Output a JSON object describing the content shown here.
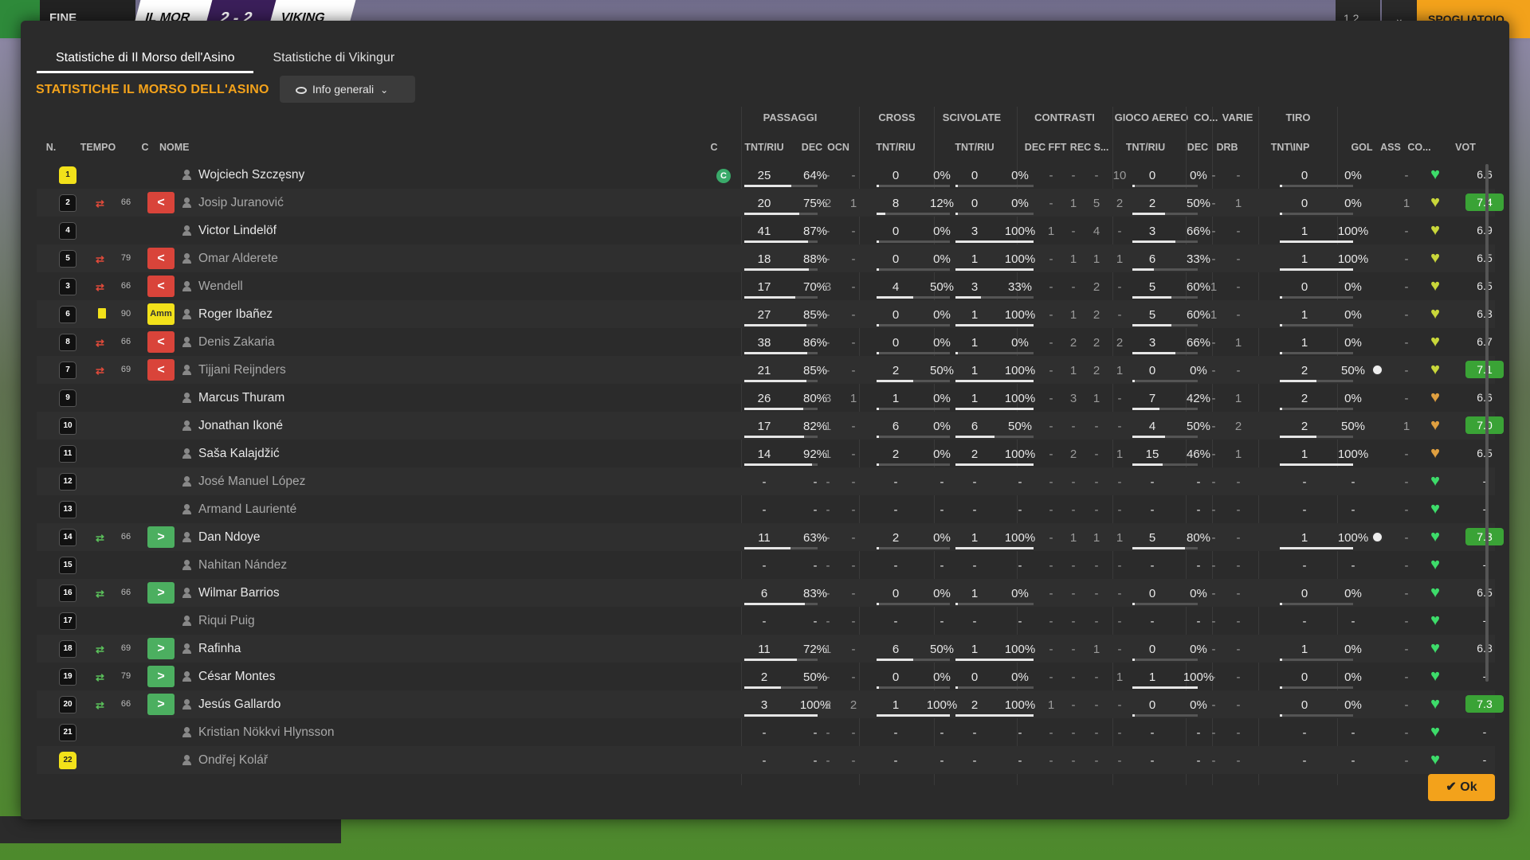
{
  "topbar": {
    "fine_partita": "FINE PARTITA",
    "team1": "IL MOR",
    "score": "2 - 2",
    "team2": "VIKING",
    "ratio": "1.2",
    "spogliatoio": "SPOGLIATOIO"
  },
  "tabs": [
    "Statistiche di Il Morso dell'Asino",
    "Statistiche di Vikingur"
  ],
  "section_title": "STATISTICHE IL MORSO DELL'ASINO",
  "dropdown_label": "Info generali",
  "groups": [
    "PASSAGGI",
    "CROSS",
    "SCIVOLATE",
    "CONTRASTI",
    "GIOCO AEREO",
    "CO...",
    "VARIE",
    "TIRO"
  ],
  "columns": [
    "N.",
    "TEMPO",
    "C",
    "NOME",
    "C",
    "TNT/RIU",
    "DEC",
    "OCN",
    "TNT/RIU",
    "TNT/RIU",
    "DEC",
    "FFT",
    "REC",
    "S...",
    "TNT/RIU",
    "DEC",
    "DRB",
    "TNT\\INP",
    "GOL",
    "ASS",
    "CO...",
    "VOT"
  ],
  "ok_label": "Ok",
  "players": [
    {
      "n": "1",
      "gk": true,
      "min": "",
      "sub": "",
      "c": "",
      "name": "Wojciech Szczęsny",
      "active": true,
      "captain": "C",
      "pass": [
        "25",
        "64%"
      ],
      "pdec": "-",
      "pocn": "-",
      "cross": [
        "0",
        "0%"
      ],
      "sciv": [
        "0",
        "0%"
      ],
      "cdec": "-",
      "fft": "-",
      "rec": "-",
      "s": "10",
      "aer": [
        "0",
        "0%"
      ],
      "codec": "-",
      "drb": "-",
      "tiro": [
        "0",
        "0%"
      ],
      "gol": "",
      "ass": "-",
      "heart": "g",
      "vot": "6.6",
      "good": false
    },
    {
      "n": "2",
      "gk": false,
      "min": "66",
      "sub": "out",
      "c": "<",
      "name": "Josip Juranović",
      "active": false,
      "pass": [
        "20",
        "75%"
      ],
      "pdec": "2",
      "pocn": "1",
      "cross": [
        "8",
        "12%"
      ],
      "sciv": [
        "0",
        "0%"
      ],
      "cdec": "-",
      "fft": "1",
      "rec": "5",
      "s": "2",
      "aer": [
        "2",
        "50%"
      ],
      "codec": "-",
      "drb": "1",
      "tiro": [
        "0",
        "0%"
      ],
      "gol": "",
      "ass": "1",
      "heart": "y",
      "vot": "7.4",
      "good": true
    },
    {
      "n": "4",
      "gk": false,
      "min": "",
      "sub": "",
      "c": "",
      "name": "Victor Lindelöf",
      "active": true,
      "pass": [
        "41",
        "87%"
      ],
      "pdec": "-",
      "pocn": "-",
      "cross": [
        "0",
        "0%"
      ],
      "sciv": [
        "3",
        "100%"
      ],
      "cdec": "1",
      "fft": "-",
      "rec": "4",
      "s": "-",
      "aer": [
        "3",
        "66%"
      ],
      "codec": "-",
      "drb": "-",
      "tiro": [
        "1",
        "100%"
      ],
      "gol": "",
      "ass": "-",
      "heart": "y",
      "vot": "6.9",
      "good": false
    },
    {
      "n": "5",
      "gk": false,
      "min": "79",
      "sub": "out",
      "c": "<",
      "name": "Omar Alderete",
      "active": false,
      "pass": [
        "18",
        "88%"
      ],
      "pdec": "-",
      "pocn": "-",
      "cross": [
        "0",
        "0%"
      ],
      "sciv": [
        "1",
        "100%"
      ],
      "cdec": "-",
      "fft": "1",
      "rec": "1",
      "s": "1",
      "aer": [
        "6",
        "33%"
      ],
      "codec": "-",
      "drb": "-",
      "tiro": [
        "1",
        "100%"
      ],
      "gol": "",
      "ass": "-",
      "heart": "y",
      "vot": "6.5",
      "good": false
    },
    {
      "n": "3",
      "gk": false,
      "min": "66",
      "sub": "out",
      "c": "<",
      "name": "Wendell",
      "active": false,
      "pass": [
        "17",
        "70%"
      ],
      "pdec": "3",
      "pocn": "-",
      "cross": [
        "4",
        "50%"
      ],
      "sciv": [
        "3",
        "33%"
      ],
      "cdec": "-",
      "fft": "-",
      "rec": "2",
      "s": "-",
      "aer": [
        "5",
        "60%"
      ],
      "codec": "1",
      "drb": "-",
      "tiro": [
        "0",
        "0%"
      ],
      "gol": "",
      "ass": "-",
      "heart": "y",
      "vot": "6.5",
      "good": false
    },
    {
      "n": "6",
      "gk": false,
      "min": "90",
      "sub": "yellow",
      "c": "Amm",
      "name": "Roger Ibañez",
      "active": true,
      "pass": [
        "27",
        "85%"
      ],
      "pdec": "-",
      "pocn": "-",
      "cross": [
        "0",
        "0%"
      ],
      "sciv": [
        "1",
        "100%"
      ],
      "cdec": "-",
      "fft": "1",
      "rec": "2",
      "s": "-",
      "aer": [
        "5",
        "60%"
      ],
      "codec": "1",
      "drb": "-",
      "tiro": [
        "1",
        "0%"
      ],
      "gol": "",
      "ass": "-",
      "heart": "y",
      "vot": "6.3",
      "good": false
    },
    {
      "n": "8",
      "gk": false,
      "min": "66",
      "sub": "out",
      "c": "<",
      "name": "Denis Zakaria",
      "active": false,
      "pass": [
        "38",
        "86%"
      ],
      "pdec": "-",
      "pocn": "-",
      "cross": [
        "0",
        "0%"
      ],
      "sciv": [
        "1",
        "0%"
      ],
      "cdec": "-",
      "fft": "2",
      "rec": "2",
      "s": "2",
      "aer": [
        "3",
        "66%"
      ],
      "codec": "-",
      "drb": "1",
      "tiro": [
        "1",
        "0%"
      ],
      "gol": "",
      "ass": "-",
      "heart": "y",
      "vot": "6.7",
      "good": false
    },
    {
      "n": "7",
      "gk": false,
      "min": "69",
      "sub": "out",
      "c": "<",
      "name": "Tijjani Reijnders",
      "active": false,
      "pass": [
        "21",
        "85%"
      ],
      "pdec": "-",
      "pocn": "-",
      "cross": [
        "2",
        "50%"
      ],
      "sciv": [
        "1",
        "100%"
      ],
      "cdec": "-",
      "fft": "1",
      "rec": "2",
      "s": "1",
      "aer": [
        "0",
        "0%"
      ],
      "codec": "-",
      "drb": "-",
      "tiro": [
        "2",
        "50%"
      ],
      "gol": "ball",
      "ass": "-",
      "heart": "y",
      "vot": "7.1",
      "good": true
    },
    {
      "n": "9",
      "gk": false,
      "min": "",
      "sub": "",
      "c": "",
      "name": "Marcus Thuram",
      "active": true,
      "pass": [
        "26",
        "80%"
      ],
      "pdec": "3",
      "pocn": "1",
      "cross": [
        "1",
        "0%"
      ],
      "sciv": [
        "1",
        "100%"
      ],
      "cdec": "-",
      "fft": "3",
      "rec": "1",
      "s": "-",
      "aer": [
        "7",
        "42%"
      ],
      "codec": "-",
      "drb": "1",
      "tiro": [
        "2",
        "0%"
      ],
      "gol": "",
      "ass": "-",
      "heart": "o",
      "vot": "6.6",
      "good": false
    },
    {
      "n": "10",
      "gk": false,
      "min": "",
      "sub": "",
      "c": "",
      "name": "Jonathan Ikoné",
      "active": true,
      "pass": [
        "17",
        "82%"
      ],
      "pdec": "1",
      "pocn": "-",
      "cross": [
        "6",
        "0%"
      ],
      "sciv": [
        "6",
        "50%"
      ],
      "cdec": "-",
      "fft": "-",
      "rec": "-",
      "s": "-",
      "aer": [
        "4",
        "50%"
      ],
      "codec": "-",
      "drb": "2",
      "tiro": [
        "2",
        "50%"
      ],
      "gol": "",
      "ass": "1",
      "heart": "o",
      "vot": "7.0",
      "good": true
    },
    {
      "n": "11",
      "gk": false,
      "min": "",
      "sub": "",
      "c": "",
      "name": "Saša Kalajdžić",
      "active": true,
      "pass": [
        "14",
        "92%"
      ],
      "pdec": "1",
      "pocn": "-",
      "cross": [
        "2",
        "0%"
      ],
      "sciv": [
        "2",
        "100%"
      ],
      "cdec": "-",
      "fft": "2",
      "rec": "-",
      "s": "1",
      "aer": [
        "15",
        "46%"
      ],
      "codec": "-",
      "drb": "1",
      "tiro": [
        "1",
        "100%"
      ],
      "gol": "",
      "ass": "-",
      "heart": "o",
      "vot": "6.5",
      "good": false
    },
    {
      "n": "12",
      "gk": false,
      "min": "",
      "sub": "",
      "c": "",
      "name": "José Manuel López",
      "active": false,
      "pass": [
        "-",
        "-"
      ],
      "pdec": "-",
      "pocn": "-",
      "cross": [
        "-",
        "-"
      ],
      "sciv": [
        "-",
        "-"
      ],
      "cdec": "-",
      "fft": "-",
      "rec": "-",
      "s": "-",
      "aer": [
        "-",
        "-"
      ],
      "codec": "-",
      "drb": "-",
      "tiro": [
        "-",
        "-"
      ],
      "gol": "",
      "ass": "-",
      "heart": "g",
      "vot": "-",
      "good": false
    },
    {
      "n": "13",
      "gk": false,
      "min": "",
      "sub": "",
      "c": "",
      "name": "Armand Laurienté",
      "active": false,
      "pass": [
        "-",
        "-"
      ],
      "pdec": "-",
      "pocn": "-",
      "cross": [
        "-",
        "-"
      ],
      "sciv": [
        "-",
        "-"
      ],
      "cdec": "-",
      "fft": "-",
      "rec": "-",
      "s": "-",
      "aer": [
        "-",
        "-"
      ],
      "codec": "-",
      "drb": "-",
      "tiro": [
        "-",
        "-"
      ],
      "gol": "",
      "ass": "-",
      "heart": "g",
      "vot": "-",
      "good": false
    },
    {
      "n": "14",
      "gk": false,
      "min": "66",
      "sub": "in",
      "c": ">",
      "name": "Dan Ndoye",
      "active": true,
      "pass": [
        "11",
        "63%"
      ],
      "pdec": "-",
      "pocn": "-",
      "cross": [
        "2",
        "0%"
      ],
      "sciv": [
        "1",
        "100%"
      ],
      "cdec": "-",
      "fft": "1",
      "rec": "1",
      "s": "1",
      "aer": [
        "5",
        "80%"
      ],
      "codec": "-",
      "drb": "-",
      "tiro": [
        "1",
        "100%"
      ],
      "gol": "ball",
      "ass": "-",
      "heart": "g",
      "vot": "7.3",
      "good": true
    },
    {
      "n": "15",
      "gk": false,
      "min": "",
      "sub": "",
      "c": "",
      "name": "Nahitan Nández",
      "active": false,
      "pass": [
        "-",
        "-"
      ],
      "pdec": "-",
      "pocn": "-",
      "cross": [
        "-",
        "-"
      ],
      "sciv": [
        "-",
        "-"
      ],
      "cdec": "-",
      "fft": "-",
      "rec": "-",
      "s": "-",
      "aer": [
        "-",
        "-"
      ],
      "codec": "-",
      "drb": "-",
      "tiro": [
        "-",
        "-"
      ],
      "gol": "",
      "ass": "-",
      "heart": "g",
      "vot": "-",
      "good": false
    },
    {
      "n": "16",
      "gk": false,
      "min": "66",
      "sub": "in",
      "c": ">",
      "name": "Wilmar Barrios",
      "active": true,
      "pass": [
        "6",
        "83%"
      ],
      "pdec": "-",
      "pocn": "-",
      "cross": [
        "0",
        "0%"
      ],
      "sciv": [
        "1",
        "0%"
      ],
      "cdec": "-",
      "fft": "-",
      "rec": "-",
      "s": "-",
      "aer": [
        "0",
        "0%"
      ],
      "codec": "-",
      "drb": "-",
      "tiro": [
        "0",
        "0%"
      ],
      "gol": "",
      "ass": "-",
      "heart": "g",
      "vot": "6.5",
      "good": false
    },
    {
      "n": "17",
      "gk": false,
      "min": "",
      "sub": "",
      "c": "",
      "name": "Riqui Puig",
      "active": false,
      "pass": [
        "-",
        "-"
      ],
      "pdec": "-",
      "pocn": "-",
      "cross": [
        "-",
        "-"
      ],
      "sciv": [
        "-",
        "-"
      ],
      "cdec": "-",
      "fft": "-",
      "rec": "-",
      "s": "-",
      "aer": [
        "-",
        "-"
      ],
      "codec": "-",
      "drb": "-",
      "tiro": [
        "-",
        "-"
      ],
      "gol": "",
      "ass": "-",
      "heart": "g",
      "vot": "-",
      "good": false
    },
    {
      "n": "18",
      "gk": false,
      "min": "69",
      "sub": "in",
      "c": ">",
      "name": "Rafinha",
      "active": true,
      "pass": [
        "11",
        "72%"
      ],
      "pdec": "1",
      "pocn": "-",
      "cross": [
        "6",
        "50%"
      ],
      "sciv": [
        "1",
        "100%"
      ],
      "cdec": "-",
      "fft": "-",
      "rec": "1",
      "s": "-",
      "aer": [
        "0",
        "0%"
      ],
      "codec": "-",
      "drb": "-",
      "tiro": [
        "1",
        "0%"
      ],
      "gol": "",
      "ass": "-",
      "heart": "g",
      "vot": "6.8",
      "good": false
    },
    {
      "n": "19",
      "gk": false,
      "min": "79",
      "sub": "in",
      "c": ">",
      "name": "César Montes",
      "active": true,
      "pass": [
        "2",
        "50%"
      ],
      "pdec": "-",
      "pocn": "-",
      "cross": [
        "0",
        "0%"
      ],
      "sciv": [
        "0",
        "0%"
      ],
      "cdec": "-",
      "fft": "-",
      "rec": "-",
      "s": "1",
      "aer": [
        "1",
        "100%"
      ],
      "codec": "-",
      "drb": "-",
      "tiro": [
        "0",
        "0%"
      ],
      "gol": "",
      "ass": "-",
      "heart": "g",
      "vot": "-",
      "good": false
    },
    {
      "n": "20",
      "gk": false,
      "min": "66",
      "sub": "in",
      "c": ">",
      "name": "Jesús Gallardo",
      "active": true,
      "pass": [
        "3",
        "100%"
      ],
      "pdec": "2",
      "pocn": "2",
      "cross": [
        "1",
        "100%"
      ],
      "sciv": [
        "2",
        "100%"
      ],
      "cdec": "1",
      "fft": "-",
      "rec": "-",
      "s": "-",
      "aer": [
        "0",
        "0%"
      ],
      "codec": "-",
      "drb": "-",
      "tiro": [
        "0",
        "0%"
      ],
      "gol": "",
      "ass": "-",
      "heart": "g",
      "vot": "7.3",
      "good": true
    },
    {
      "n": "21",
      "gk": false,
      "min": "",
      "sub": "",
      "c": "",
      "name": "Kristian Nökkvi Hlynsson",
      "active": false,
      "pass": [
        "-",
        "-"
      ],
      "pdec": "-",
      "pocn": "-",
      "cross": [
        "-",
        "-"
      ],
      "sciv": [
        "-",
        "-"
      ],
      "cdec": "-",
      "fft": "-",
      "rec": "-",
      "s": "-",
      "aer": [
        "-",
        "-"
      ],
      "codec": "-",
      "drb": "-",
      "tiro": [
        "-",
        "-"
      ],
      "gol": "",
      "ass": "-",
      "heart": "g",
      "vot": "-",
      "good": false
    },
    {
      "n": "22",
      "gk": true,
      "min": "",
      "sub": "",
      "c": "",
      "name": "Ondřej Kolář",
      "active": false,
      "pass": [
        "-",
        "-"
      ],
      "pdec": "-",
      "pocn": "-",
      "cross": [
        "-",
        "-"
      ],
      "sciv": [
        "-",
        "-"
      ],
      "cdec": "-",
      "fft": "-",
      "rec": "-",
      "s": "-",
      "aer": [
        "-",
        "-"
      ],
      "codec": "-",
      "drb": "-",
      "tiro": [
        "-",
        "-"
      ],
      "gol": "",
      "ass": "-",
      "heart": "g",
      "vot": "-",
      "good": false
    }
  ]
}
